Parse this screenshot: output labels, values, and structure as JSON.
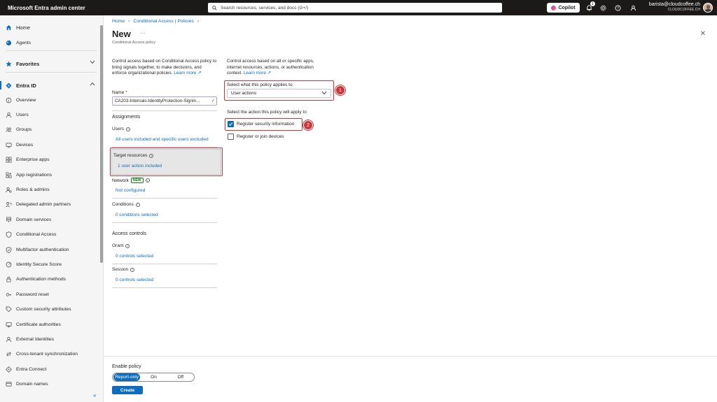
{
  "app": {
    "title": "Microsoft Entra admin center"
  },
  "search": {
    "placeholder": "Search resources, services, and docs (G+/)"
  },
  "topbar": {
    "copilot_label": "Copilot",
    "notification_count": "1"
  },
  "account": {
    "email": "barista@cloudcoffee.ch",
    "tenant": "CLOUDCOFFEE.CH"
  },
  "sidebar": {
    "home": "Home",
    "agents": "Agents",
    "favorites": "Favorites",
    "entra_id": "Entra ID",
    "items": [
      "Overview",
      "Users",
      "Groups",
      "Devices",
      "Enterprise apps",
      "App registrations",
      "Roles & admins",
      "Delegated admin partners",
      "Domain services",
      "Conditional Access",
      "Multifactor authentication",
      "Identity Secure Score",
      "Authentication methods",
      "Password reset",
      "Custom security attributes",
      "Certificate authorities",
      "External Identities",
      "Cross-tenant synchronization",
      "Entra Connect",
      "Domain names"
    ],
    "collapse_glyph": "«"
  },
  "breadcrumb": {
    "home": "Home",
    "policies": "Conditional Access | Policies"
  },
  "page": {
    "title": "New",
    "more": "···",
    "subtitle": "Conditional Access policy",
    "close": "✕"
  },
  "left": {
    "description": "Control access based on Conditional Access policy to bring signals together, to make decisions, and enforce organizational policies.",
    "learn_more": "Learn more",
    "name_label": "Name",
    "name_required": "*",
    "name_value": "CA203-Internals-IdentityProtection-SignIn...",
    "assignments": "Assignments",
    "users_label": "Users",
    "users_value": "All users included and specific users excluded",
    "target_label": "Target resources",
    "target_value": "1 user action included",
    "network_label": "Network",
    "network_badge": "NEW",
    "network_value": "Not configured",
    "conditions_label": "Conditions",
    "conditions_value": "0 conditions selected",
    "access_controls": "Access controls",
    "grant_label": "Grant",
    "grant_value": "0 controls selected",
    "session_label": "Session",
    "session_value": "0 controls selected"
  },
  "right": {
    "description": "Control access based on all or specific apps, internet resources, actions, or authentication context.",
    "learn_more": "Learn more",
    "applies_label": "Select what this policy applies to",
    "applies_value": "User actions",
    "action_label": "Select the action this policy will apply to",
    "option1": "Register security information",
    "option1_checked": true,
    "option2": "Register or join devices",
    "option2_checked": false
  },
  "annotations": {
    "badge1": "1",
    "badge2": "2",
    "color": "#d13438"
  },
  "footer": {
    "enable_label": "Enable policy",
    "options": [
      "Report-only",
      "On",
      "Off"
    ],
    "selected": "Report-only",
    "create": "Create"
  },
  "colors": {
    "accent": "#0f6cbd",
    "topbar": "#1b1a19"
  }
}
